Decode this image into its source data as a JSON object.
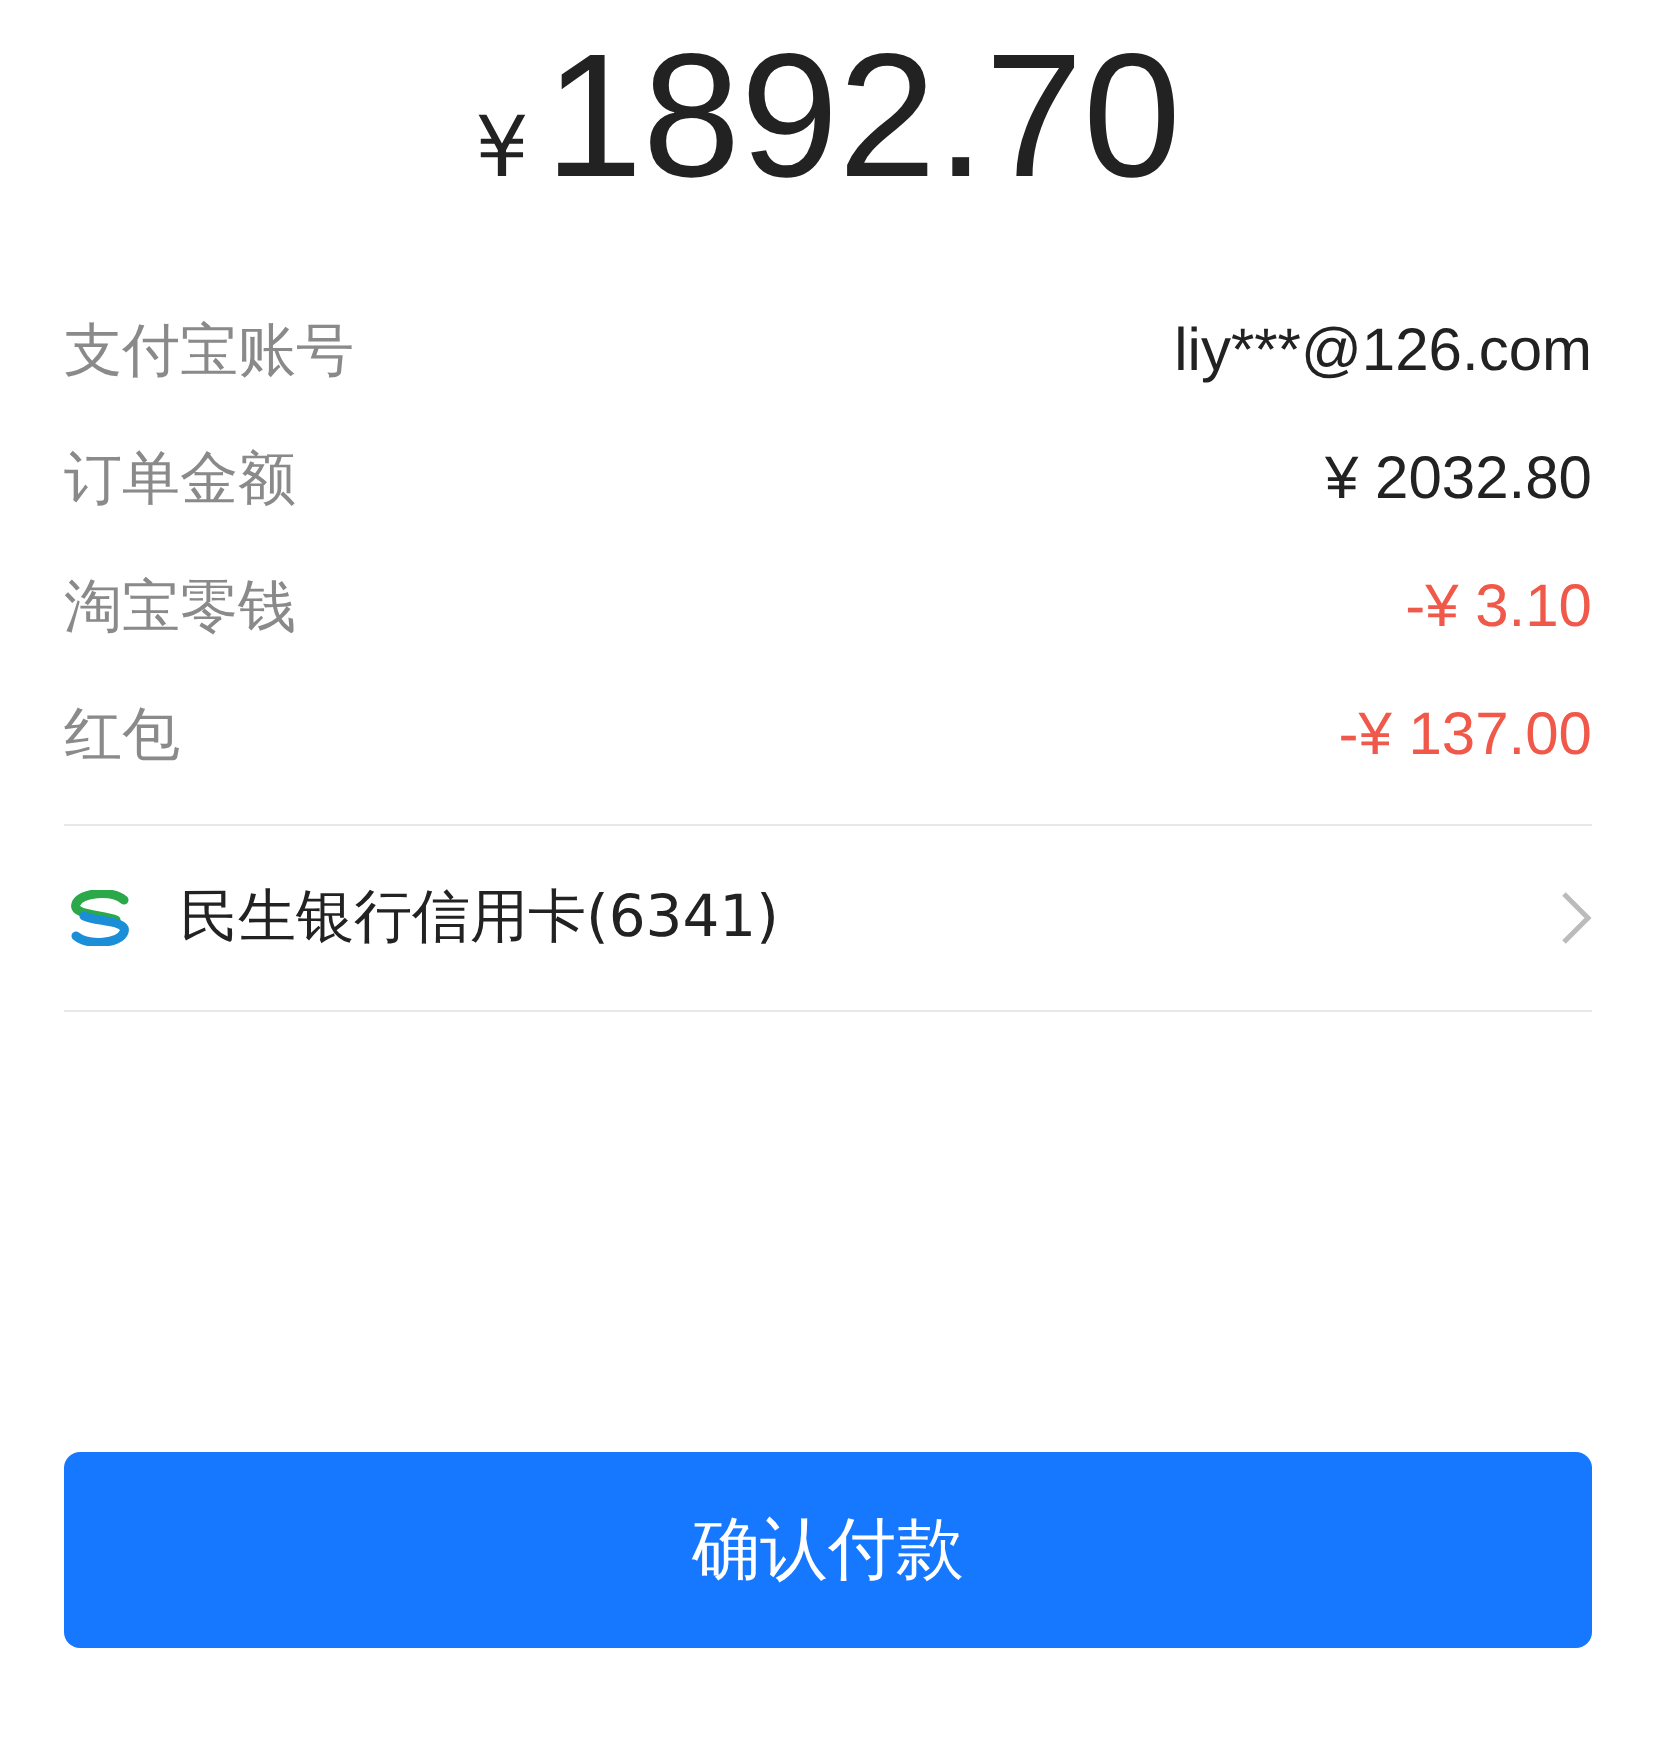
{
  "amount": {
    "currency": "¥",
    "value": "1892.70"
  },
  "details": [
    {
      "label": "支付宝账号",
      "value": "liy***@126.com",
      "kind": "normal"
    },
    {
      "label": "订单金额",
      "value": "¥ 2032.80",
      "kind": "normal"
    },
    {
      "label": "淘宝零钱",
      "value": "-¥ 3.10",
      "kind": "deduction"
    },
    {
      "label": "红包",
      "value": "-¥ 137.00",
      "kind": "deduction"
    }
  ],
  "payment_method": {
    "label": "民生银行信用卡(6341)"
  },
  "confirm_button": {
    "label": "确认付款"
  }
}
